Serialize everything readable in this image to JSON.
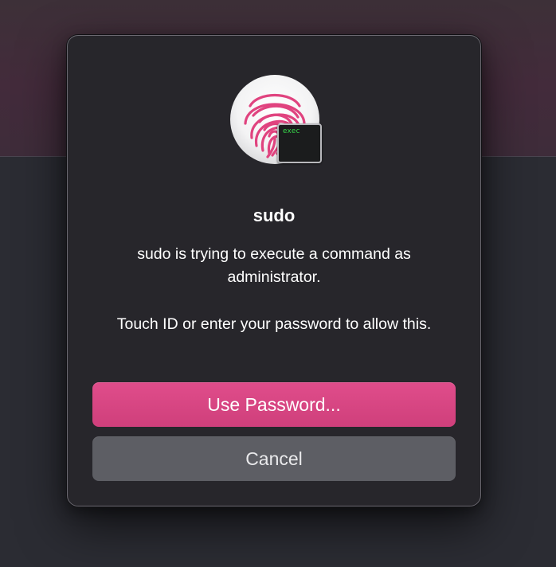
{
  "dialog": {
    "title": "sudo",
    "message": "sudo is trying to execute a command as administrator.",
    "instruction": "Touch ID or enter your password to allow this.",
    "icon": "touch-id-fingerprint-icon",
    "badge": {
      "icon": "terminal-icon",
      "text": "exec"
    },
    "buttons": {
      "primary_label": "Use Password...",
      "cancel_label": "Cancel"
    }
  },
  "colors": {
    "accent": "#d94683",
    "fingerprint": "#e0437f",
    "badge_text": "#37d94a",
    "cancel_button": "#5d5e64"
  }
}
